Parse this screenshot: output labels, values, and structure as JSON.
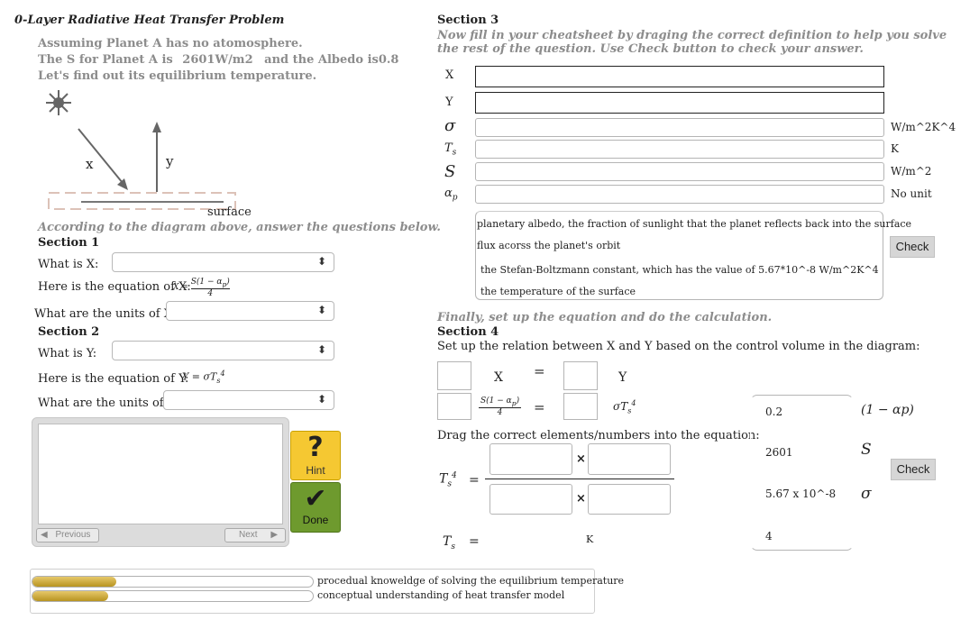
{
  "problem": {
    "title": "0-Layer Radiative Heat Transfer Problem",
    "line1": "Assuming Planet A has no atomosphere.",
    "line2_prefix": "The S for Planet A is",
    "s_value": "2601W/m2",
    "line2_mid": "and the Albedo is",
    "albedo": "0.8",
    "line3": "Let's find out its equilibrium temperature."
  },
  "diagram": {
    "sun_glyph": "✹",
    "x_label": "x",
    "y_label": "y",
    "surface_label": "surface",
    "caption": "According to the diagram above, answer the questions below."
  },
  "section1": {
    "heading": "Section 1",
    "q_what": "What is X:",
    "q_equation": "Here is the equation of X:",
    "equation_x": "X = S(1 − αp) / 4",
    "q_units": "What are the units of X:"
  },
  "section2": {
    "heading": "Section 2",
    "q_what": "What is Y:",
    "q_equation": "Here is the equation of Y:",
    "equation_y": "Y = σT",
    "q_units": "What are the units of Y:"
  },
  "tutor": {
    "hint_label": "Hint",
    "done_label": "Done",
    "prev_label": "Previous",
    "next_label": "Next",
    "hint_icon": "question-mark",
    "done_icon": "check-mark",
    "hint_color": "#f5c832",
    "done_color": "#6e9a2e"
  },
  "progress": [
    {
      "label": "procedual knoweldge of solving the equilibrium temperature",
      "fill": 0.3
    },
    {
      "label": "conceptual understanding of heat transfer model",
      "fill": 0.27
    }
  ],
  "section3": {
    "heading": "Section 3",
    "instructions": "Now fill in your cheatsheet by draging the correct definition to help you solve the rest of the question. Use Check button to check your answer.",
    "rows": [
      {
        "symbol": "X",
        "unit": ""
      },
      {
        "symbol": "Y",
        "unit": ""
      },
      {
        "symbol": "σ",
        "unit": "W/m^2K^4"
      },
      {
        "symbol": "Ts",
        "unit": "K"
      },
      {
        "symbol": "S",
        "unit": "W/m^2"
      },
      {
        "symbol": "αp",
        "unit": "No unit"
      }
    ],
    "definitions": [
      "planetary albedo, the fraction of sunlight that the planet reflects back into the surface",
      "flux acorss the planet's orbit",
      "the Stefan-Boltzmann constant, which has the value of 5.67*10^-8 W/m^2K^4",
      "the temperature of the surface"
    ],
    "check_label": "Check"
  },
  "section4": {
    "lead": "Finally, set up the equation and do the calculation.",
    "heading": "Section 4",
    "relation_prompt": "Set up the relation between X and Y based on the control volume in the diagram:",
    "eq_x": "X",
    "eq_y": "Y",
    "equals": "=",
    "eq_frac_num": "S(1 − αp)",
    "eq_frac_den": "4",
    "eq_sigma_ts": "σT",
    "drag_prompt": "Drag the correct elements/numbers into the equation:",
    "times": "×",
    "ts4_label": "Ts",
    "ts_label": "Ts",
    "unit_k": "K",
    "tokens": [
      "0.2",
      "2601",
      "5.67 x 10^-8",
      "4"
    ],
    "symbols": [
      "(1 − αp)",
      "S",
      "σ"
    ],
    "check_label": "Check"
  }
}
